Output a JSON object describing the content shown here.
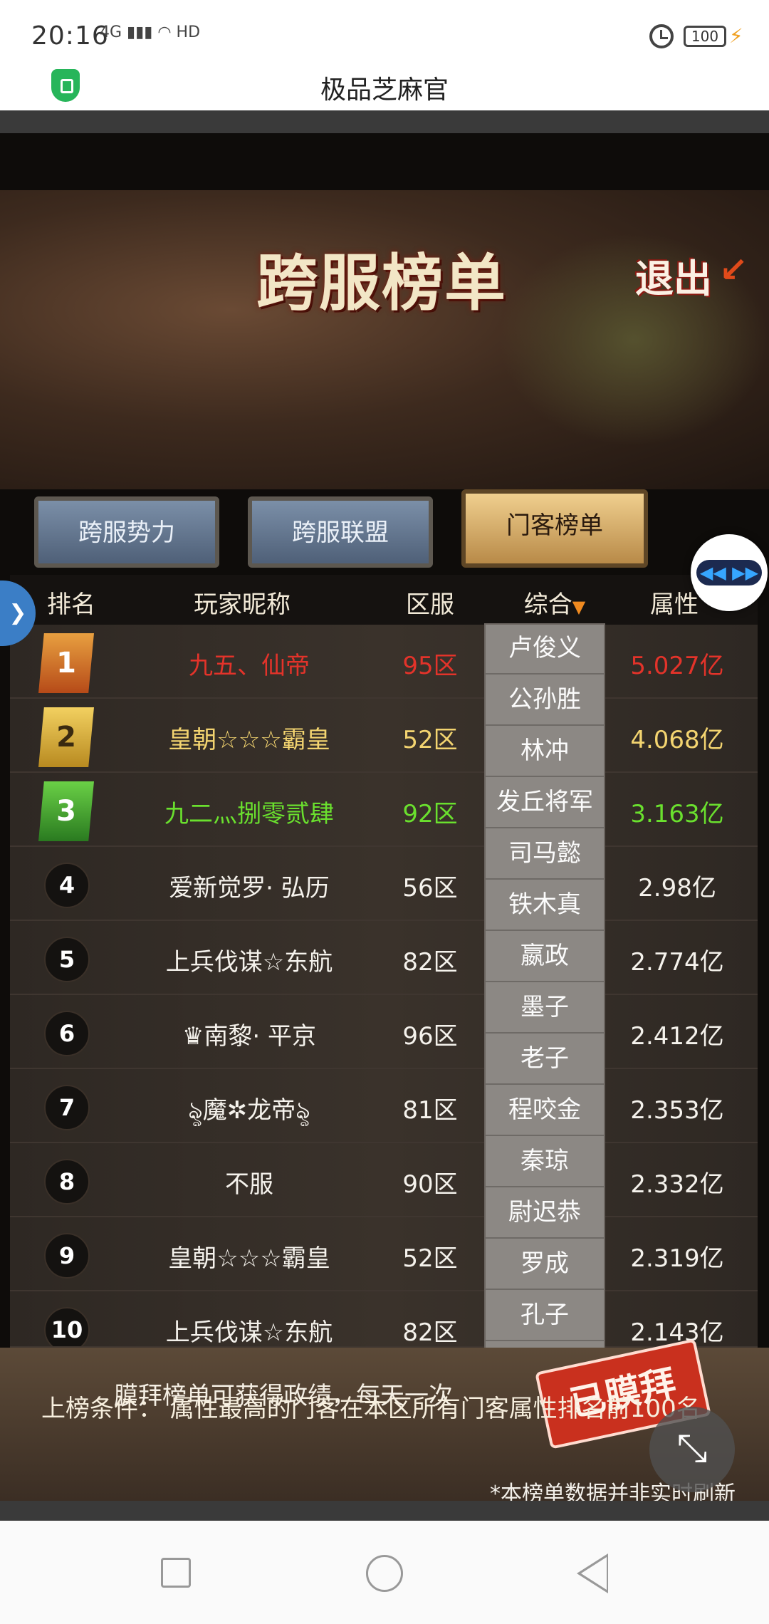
{
  "status": {
    "time": "20:16",
    "network": "4G",
    "hd": "HD",
    "battery": "100"
  },
  "app": {
    "title": "极品芝麻官"
  },
  "game": {
    "banner_title": "跨服榜单",
    "exit_label": "退出",
    "tabs": [
      {
        "label": "跨服势力",
        "active": false
      },
      {
        "label": "跨服联盟",
        "active": false
      },
      {
        "label": "门客榜单",
        "active": true
      }
    ],
    "headers": {
      "rank": "排名",
      "name": "玩家昵称",
      "server": "区服",
      "filter": "综合",
      "filter_caret": "▼",
      "attribute": "属性"
    },
    "rows": [
      {
        "rank": "1",
        "name": "九五、仙帝",
        "server": "95区",
        "value": "5.027亿",
        "color": "#e3332a"
      },
      {
        "rank": "2",
        "name": "皇朝☆☆☆霸皇",
        "server": "52区",
        "value": "4.068亿",
        "color": "#f3d470"
      },
      {
        "rank": "3",
        "name": "九二灬捌零贰肆",
        "server": "92区",
        "value": "3.163亿",
        "color": "#6ae02e"
      },
      {
        "rank": "4",
        "name": "爱新觉罗· 弘历",
        "server": "56区",
        "value": "2.98亿",
        "color": "#f5f2ec"
      },
      {
        "rank": "5",
        "name": "上兵伐谋☆东航",
        "server": "82区",
        "value": "2.774亿",
        "color": "#f5f2ec"
      },
      {
        "rank": "6",
        "name": "♛南黎· 平京",
        "server": "96区",
        "value": "2.412亿",
        "color": "#f5f2ec"
      },
      {
        "rank": "7",
        "name": "ৡ魔✲龙帝ৡ",
        "server": "81区",
        "value": "2.353亿",
        "color": "#f5f2ec"
      },
      {
        "rank": "8",
        "name": "不服",
        "server": "90区",
        "value": "2.332亿",
        "color": "#f5f2ec"
      },
      {
        "rank": "9",
        "name": "皇朝☆☆☆霸皇",
        "server": "52区",
        "value": "2.319亿",
        "color": "#f5f2ec"
      },
      {
        "rank": "10",
        "name": "上兵伐谋☆东航",
        "server": "82区",
        "value": "2.143亿",
        "color": "#f5f2ec"
      }
    ],
    "dropdown_options": [
      "卢俊义",
      "公孙胜",
      "林冲",
      "发丘将军",
      "司马懿",
      "铁木真",
      "嬴政",
      "墨子",
      "老子",
      "程咬金",
      "秦琼",
      "尉迟恭",
      "罗成",
      "孔子"
    ],
    "worship_text": "膜拜榜单可获得政绩，每天一次",
    "worship_stamp": "已膜拜",
    "condition_text": "上榜条件：  属性最高的门客在本区所有门客属性排名前100名",
    "note_text": "*本榜单数据并非实时刷新"
  },
  "icons": {
    "shield": "shield-icon",
    "alarm": "alarm-icon",
    "minimize": "minimize-icon",
    "float": "float-ball-icon"
  }
}
